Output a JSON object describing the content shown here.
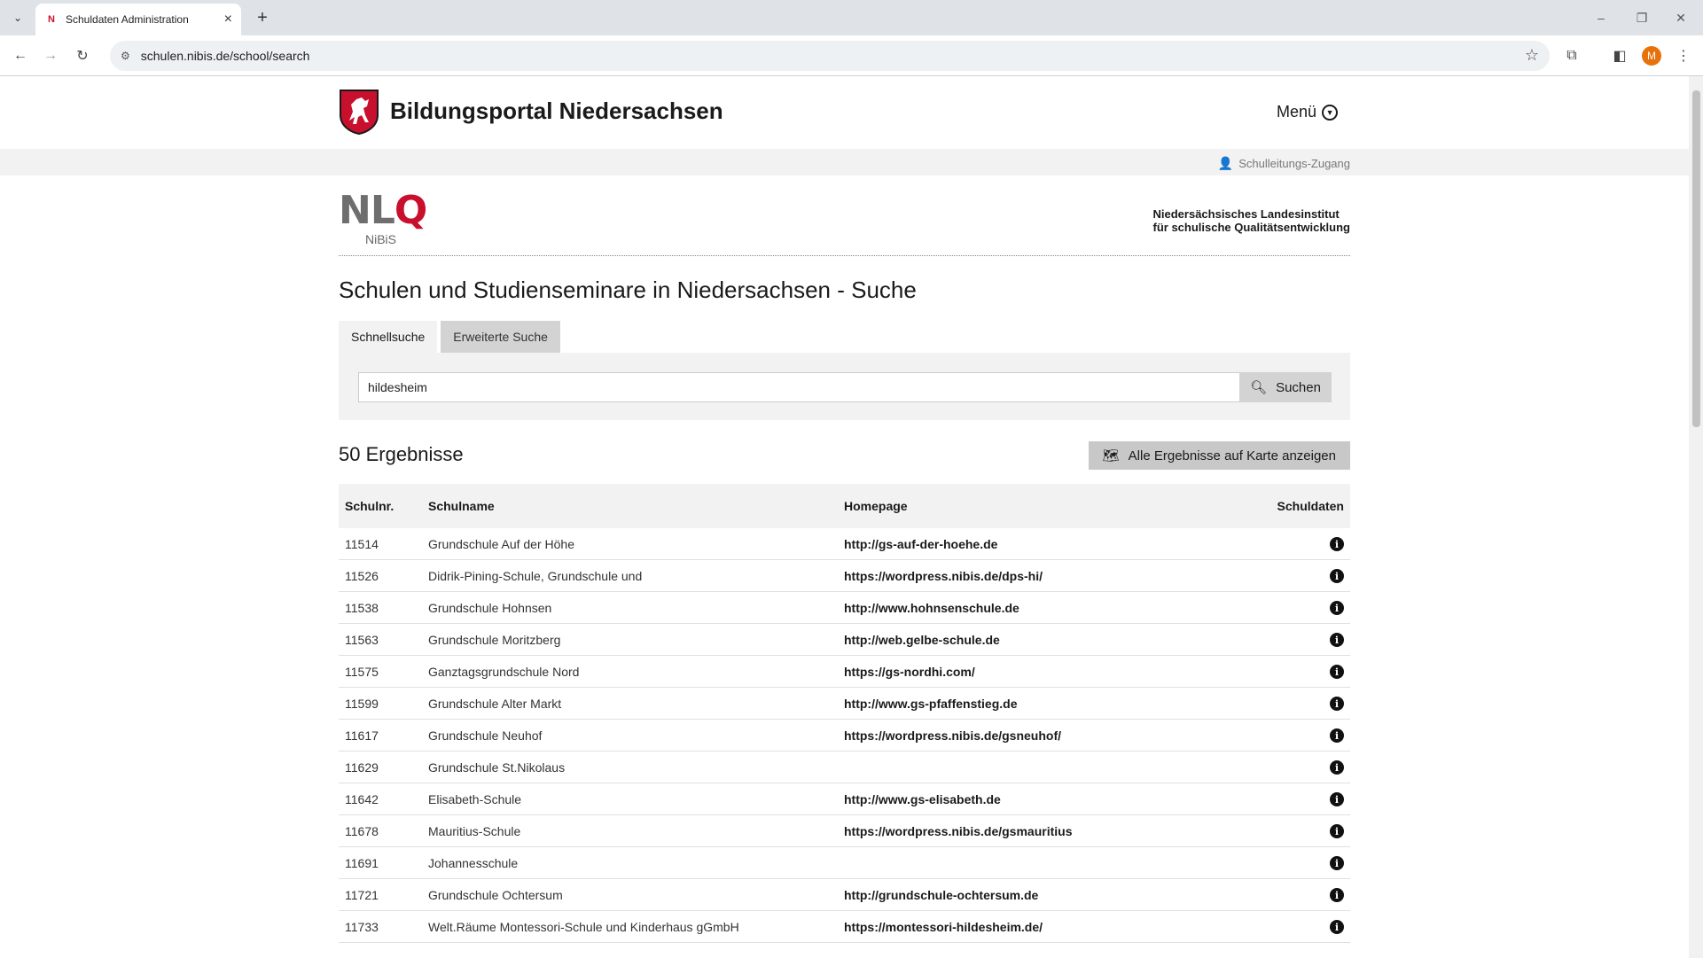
{
  "browser": {
    "tab_title": "Schuldaten Administration",
    "tab_favicon": "N",
    "url": "schulen.nibis.de/school/search",
    "avatar_letter": "M"
  },
  "header": {
    "brand": "Bildungsportal Niedersachsen",
    "menu_label": "Menü",
    "login_label": "Schulleitungs-Zugang"
  },
  "institute": {
    "logo_nl": "NL",
    "logo_q": "Q",
    "logo_sub": "NiBiS",
    "name_line1": "Niedersächsisches Landesinstitut",
    "name_line2": "für schulische Qualitätsentwicklung"
  },
  "main": {
    "title": "Schulen und Studienseminare in Niedersachsen - Suche",
    "tabs": [
      {
        "label": "Schnellsuche"
      },
      {
        "label": "Erweiterte Suche"
      }
    ],
    "search_value": "hildesheim",
    "search_button": "Suchen",
    "results_count": "50 Ergebnisse",
    "map_button": "Alle Ergebnisse auf Karte anzeigen"
  },
  "table": {
    "headers": {
      "nr": "Schulnr.",
      "name": "Schulname",
      "home": "Homepage",
      "data": "Schuldaten"
    },
    "rows": [
      {
        "nr": "11514",
        "name": "Grundschule Auf der Höhe",
        "home": "http://gs-auf-der-hoehe.de"
      },
      {
        "nr": "11526",
        "name": "Didrik-Pining-Schule, Grundschule und",
        "home": "https://wordpress.nibis.de/dps-hi/"
      },
      {
        "nr": "11538",
        "name": "Grundschule Hohnsen",
        "home": "http://www.hohnsenschule.de"
      },
      {
        "nr": "11563",
        "name": "Grundschule Moritzberg",
        "home": "http://web.gelbe-schule.de"
      },
      {
        "nr": "11575",
        "name": "Ganztagsgrundschule Nord",
        "home": "https://gs-nordhi.com/"
      },
      {
        "nr": "11599",
        "name": "Grundschule Alter Markt",
        "home": "http://www.gs-pfaffenstieg.de"
      },
      {
        "nr": "11617",
        "name": "Grundschule Neuhof",
        "home": "https://wordpress.nibis.de/gsneuhof/"
      },
      {
        "nr": "11629",
        "name": "Grundschule St.Nikolaus",
        "home": ""
      },
      {
        "nr": "11642",
        "name": "Elisabeth-Schule",
        "home": "http://www.gs-elisabeth.de"
      },
      {
        "nr": "11678",
        "name": "Mauritius-Schule",
        "home": "https://wordpress.nibis.de/gsmauritius"
      },
      {
        "nr": "11691",
        "name": "Johannesschule",
        "home": ""
      },
      {
        "nr": "11721",
        "name": "Grundschule Ochtersum",
        "home": "http://grundschule-ochtersum.de"
      },
      {
        "nr": "11733",
        "name": "Welt.Räume Montessori-Schule und Kinderhaus gGmbH",
        "home": "https://montessori-hildesheim.de/"
      }
    ]
  }
}
